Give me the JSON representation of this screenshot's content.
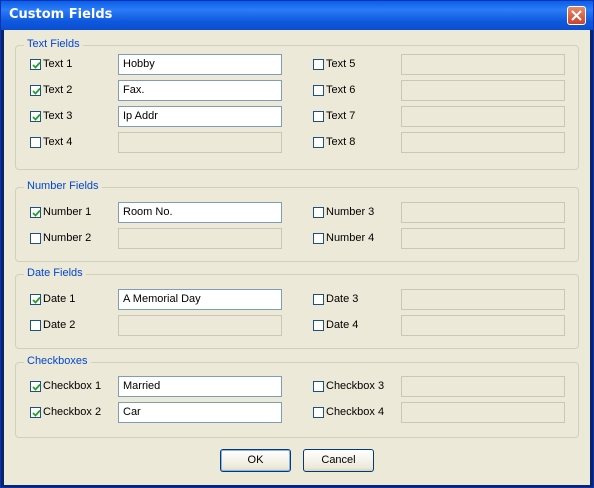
{
  "window": {
    "title": "Custom Fields"
  },
  "groups": {
    "text": {
      "title": "Text Fields",
      "left": [
        {
          "label": "Text 1",
          "checked": true,
          "value": "Hobby"
        },
        {
          "label": "Text 2",
          "checked": true,
          "value": "Fax."
        },
        {
          "label": "Text 3",
          "checked": true,
          "value": "Ip Addr"
        },
        {
          "label": "Text 4",
          "checked": false,
          "value": ""
        }
      ],
      "right": [
        {
          "label": "Text 5",
          "checked": false,
          "value": ""
        },
        {
          "label": "Text 6",
          "checked": false,
          "value": ""
        },
        {
          "label": "Text 7",
          "checked": false,
          "value": ""
        },
        {
          "label": "Text 8",
          "checked": false,
          "value": ""
        }
      ]
    },
    "number": {
      "title": "Number Fields",
      "left": [
        {
          "label": "Number 1",
          "checked": true,
          "value": "Room No."
        },
        {
          "label": "Number 2",
          "checked": false,
          "value": ""
        }
      ],
      "right": [
        {
          "label": "Number 3",
          "checked": false,
          "value": ""
        },
        {
          "label": "Number 4",
          "checked": false,
          "value": ""
        }
      ]
    },
    "date": {
      "title": "Date Fields",
      "left": [
        {
          "label": "Date 1",
          "checked": true,
          "value": "A Memorial Day"
        },
        {
          "label": "Date 2",
          "checked": false,
          "value": ""
        }
      ],
      "right": [
        {
          "label": "Date 3",
          "checked": false,
          "value": ""
        },
        {
          "label": "Date 4",
          "checked": false,
          "value": ""
        }
      ]
    },
    "checkboxes": {
      "title": "Checkboxes",
      "left": [
        {
          "label": "Checkbox 1",
          "checked": true,
          "value": "Married"
        },
        {
          "label": "Checkbox 2",
          "checked": true,
          "value": "Car"
        }
      ],
      "right": [
        {
          "label": "Checkbox 3",
          "checked": false,
          "value": ""
        },
        {
          "label": "Checkbox 4",
          "checked": false,
          "value": ""
        }
      ]
    }
  },
  "buttons": {
    "ok": "OK",
    "cancel": "Cancel"
  },
  "colors": {
    "title_bar": "#0a5fe8",
    "dialog_bg": "#ece9d8",
    "group_title": "#0046d5",
    "input_border": "#7f9db9"
  }
}
